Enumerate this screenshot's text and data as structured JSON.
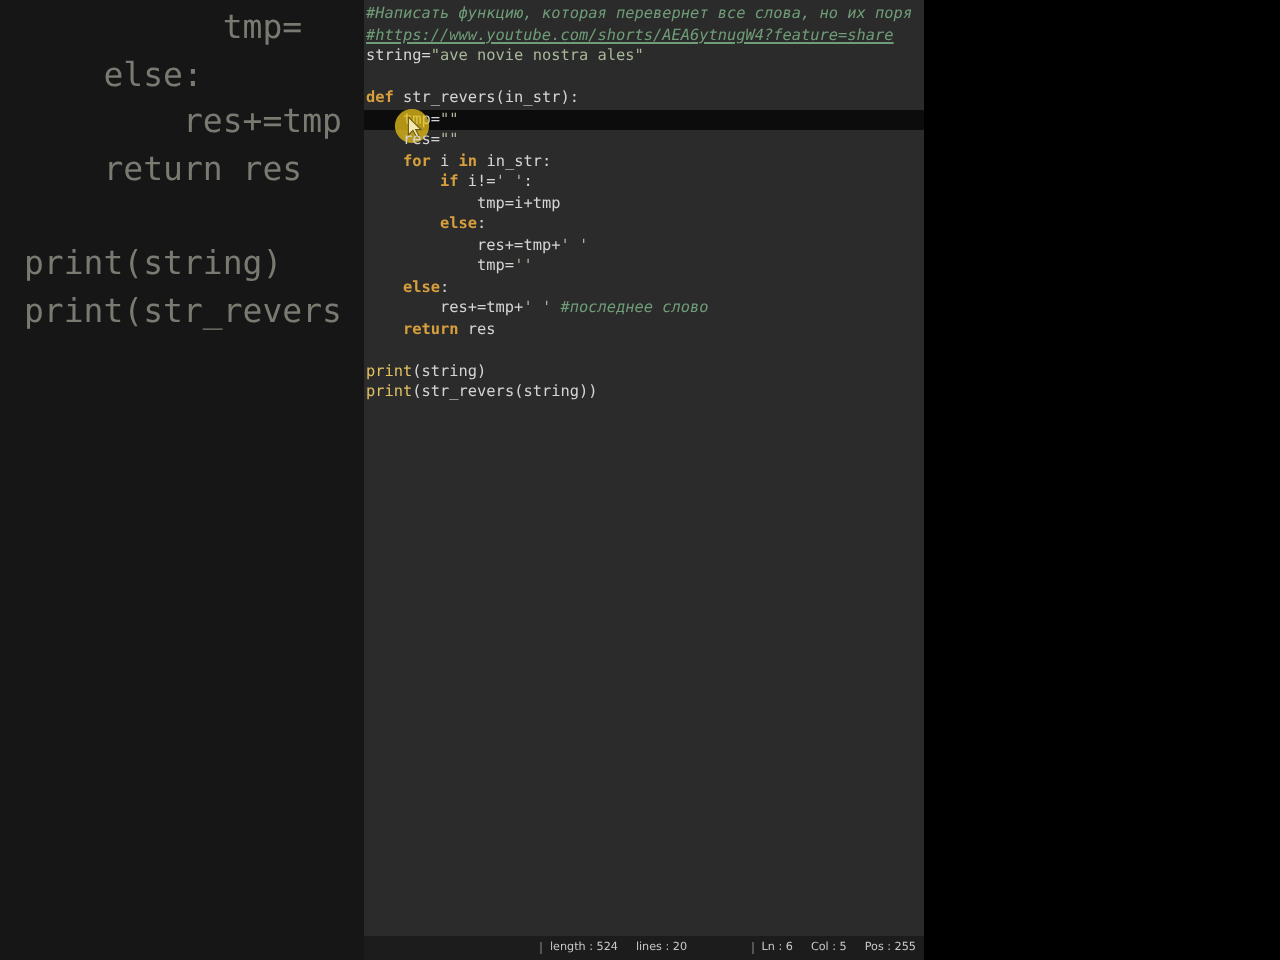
{
  "background_code": [
    {
      "kind": "code",
      "text": "          tmp="
    },
    {
      "kind": "code",
      "text": "    else:"
    },
    {
      "kind": "code",
      "text": "        res+=tmp"
    },
    {
      "kind": "code",
      "text": "    return res"
    },
    {
      "kind": "blank"
    },
    {
      "kind": "code",
      "text": "print(string)"
    },
    {
      "kind": "code",
      "text": "print(str_revers"
    }
  ],
  "editor": {
    "lines": [
      {
        "kind": "code",
        "current": false,
        "segments": [
          {
            "kind": "comment",
            "text": "#Написать функцию, которая перевернет все слова, но их поря"
          }
        ]
      },
      {
        "kind": "code",
        "current": false,
        "segments": [
          {
            "kind": "link",
            "text": "#https://www.youtube.com/shorts/AEA6ytnugW4?feature=share"
          }
        ]
      },
      {
        "kind": "code",
        "current": false,
        "segments": [
          {
            "kind": "plain",
            "text": "string="
          },
          {
            "kind": "string",
            "text": "\"ave novie nostra ales\""
          }
        ]
      },
      {
        "kind": "blank",
        "current": false
      },
      {
        "kind": "code",
        "current": false,
        "segments": [
          {
            "kind": "keyword",
            "text": "def"
          },
          {
            "kind": "plain",
            "text": " str_revers(in_str):"
          }
        ]
      },
      {
        "kind": "code",
        "current": true,
        "segments": [
          {
            "kind": "plain",
            "text": "    tmp="
          },
          {
            "kind": "string",
            "text": "\"\""
          }
        ]
      },
      {
        "kind": "code",
        "current": false,
        "segments": [
          {
            "kind": "plain",
            "text": "    res="
          },
          {
            "kind": "string",
            "text": "\"\""
          }
        ]
      },
      {
        "kind": "code",
        "current": false,
        "segments": [
          {
            "kind": "keyword",
            "text": "    for"
          },
          {
            "kind": "plain",
            "text": " i "
          },
          {
            "kind": "keyword",
            "text": "in"
          },
          {
            "kind": "plain",
            "text": " in_str:"
          }
        ]
      },
      {
        "kind": "code",
        "current": false,
        "segments": [
          {
            "kind": "keyword",
            "text": "        if"
          },
          {
            "kind": "plain",
            "text": " i!="
          },
          {
            "kind": "string",
            "text": "' '"
          },
          {
            "kind": "plain",
            "text": ":"
          }
        ]
      },
      {
        "kind": "code",
        "current": false,
        "segments": [
          {
            "kind": "plain",
            "text": "            tmp=i+tmp"
          }
        ]
      },
      {
        "kind": "code",
        "current": false,
        "segments": [
          {
            "kind": "keyword",
            "text": "        else"
          },
          {
            "kind": "plain",
            "text": ":"
          }
        ]
      },
      {
        "kind": "code",
        "current": false,
        "segments": [
          {
            "kind": "plain",
            "text": "            res+=tmp+"
          },
          {
            "kind": "string",
            "text": "' '"
          }
        ]
      },
      {
        "kind": "code",
        "current": false,
        "segments": [
          {
            "kind": "plain",
            "text": "            tmp="
          },
          {
            "kind": "string",
            "text": "''"
          }
        ]
      },
      {
        "kind": "code",
        "current": false,
        "segments": [
          {
            "kind": "keyword",
            "text": "    else"
          },
          {
            "kind": "plain",
            "text": ":"
          }
        ]
      },
      {
        "kind": "code",
        "current": false,
        "segments": [
          {
            "kind": "plain",
            "text": "        res+=tmp+"
          },
          {
            "kind": "string",
            "text": "' '"
          },
          {
            "kind": "comment",
            "text": " #последнее слово"
          }
        ]
      },
      {
        "kind": "code",
        "current": false,
        "segments": [
          {
            "kind": "keyword",
            "text": "    return"
          },
          {
            "kind": "plain",
            "text": " res"
          }
        ]
      },
      {
        "kind": "blank",
        "current": false
      },
      {
        "kind": "code",
        "current": false,
        "segments": [
          {
            "kind": "builtin",
            "text": "print"
          },
          {
            "kind": "plain",
            "text": "(string)"
          }
        ]
      },
      {
        "kind": "code",
        "current": false,
        "segments": [
          {
            "kind": "builtin",
            "text": "print"
          },
          {
            "kind": "plain",
            "text": "(str_revers(string))"
          }
        ]
      }
    ]
  },
  "status_bar": {
    "left": [
      "length : 524",
      "lines : 20"
    ],
    "right": [
      "Ln : 6",
      "Col : 5",
      "Pos : 255"
    ]
  }
}
